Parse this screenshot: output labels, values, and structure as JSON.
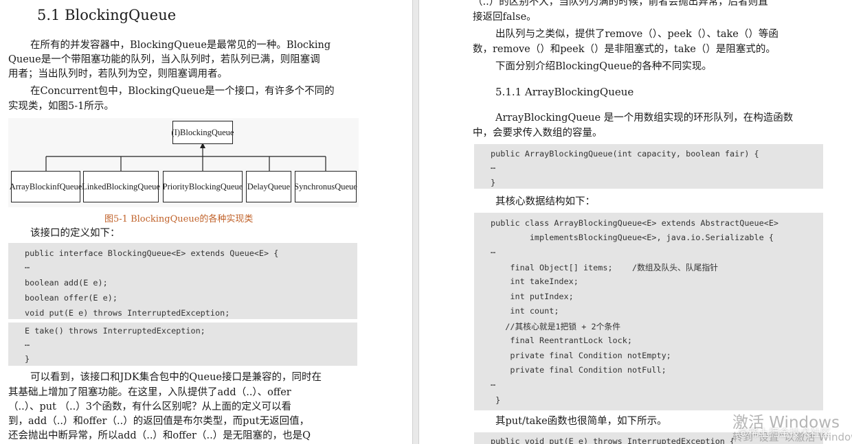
{
  "left": {
    "section_title": "5.1 BlockingQueue",
    "para1": [
      "在所有的并发容器中，BlockingQueue是最常见的一种。Blocking",
      "Queue是一个带阻塞功能的队列，当入队列时，若队列已满，则阻塞调",
      "用者；当出队列时，若队列为空，则阻塞调用者。"
    ],
    "para2": [
      "在Concurrent包中，BlockingQueue是一个接口，有许多个不同的",
      "实现类，如图5-1所示。"
    ],
    "diagram": {
      "root": "(I)BlockingQueue",
      "children": [
        "ArrayBlockinfQueue",
        "LinkedBlockingQueue",
        "PriorityBlockingQueue",
        "DelayQueue",
        "SynchronusQueue"
      ]
    },
    "figure_caption": "图5-1 BlockingQueue的各种实现类",
    "interface_intro": "该接口的定义如下：",
    "code1": [
      "public interface BlockingQueue<E> extends Queue<E> {",
      "…",
      "boolean add(E e);",
      "boolean offer(E e);",
      "void put(E e) throws InterruptedException;"
    ],
    "code2": [
      "E take() throws InterruptedException;",
      "…",
      "}"
    ],
    "para3": [
      "可以看到，该接口和JDK集合包中的Queue接口是兼容的，同时在",
      "其基础上增加了阻塞功能。在这里，入队提供了add（..）、offer",
      "（..）、put （..）3个函数，有什么区别呢？从上面的定义可以看",
      "到，add（..）和offer（..）的返回值是布尔类型，而put无返回值，",
      "还会抛出中断异常，所以add（..）和offer（..）是无阻塞的，也是Q"
    ]
  },
  "right": {
    "para_top": [
      "（..）的区别不大，当队列为满的时候，前者会抛出异常，后者则直",
      "接返回false。"
    ],
    "para_dequeue": [
      "出队列与之类似，提供了remove（）、peek（）、take（）等函",
      "数，remove（）和peek（）是非阻塞式的，take（）是阻塞式的。"
    ],
    "para_intro": "下面分别介绍BlockingQueue的各种不同实现。",
    "subsection_title": "5.1.1 ArrayBlockingQueue",
    "para_array": [
      "ArrayBlockingQueue 是一个用数组实现的环形队列，在构造函数",
      "中，会要求传入数组的容量。"
    ],
    "code_ctor": [
      "public ArrayBlockingQueue(int capacity, boolean fair) {",
      "…",
      "}"
    ],
    "core_intro": "其核心数据结构如下：",
    "code_class": [
      "public class ArrayBlockingQueue<E> extends AbstractQueue<E>",
      "        implementsBlockingQueue<E>, java.io.Serializable {",
      "…",
      "    final Object[] items;    /数组及队头、队尾指针",
      "    int takeIndex;",
      "    int putIndex;",
      "    int count;",
      "   //其核心就是1把锁 + 2个条件",
      "    final ReentrantLock lock;",
      "    private final Condition notEmpty;",
      "    private final Condition notFull;",
      "…",
      " }"
    ],
    "para_put": "其put/take函数也很简单，如下所示。",
    "code_put": "public void put(E e) throws InterruptedException {"
  },
  "overlay": {
    "activate_windows": "激活 Windows",
    "activate_hint": "转到“设置”以激活 Windows。",
    "community": "@稀土掘金技术社区"
  }
}
